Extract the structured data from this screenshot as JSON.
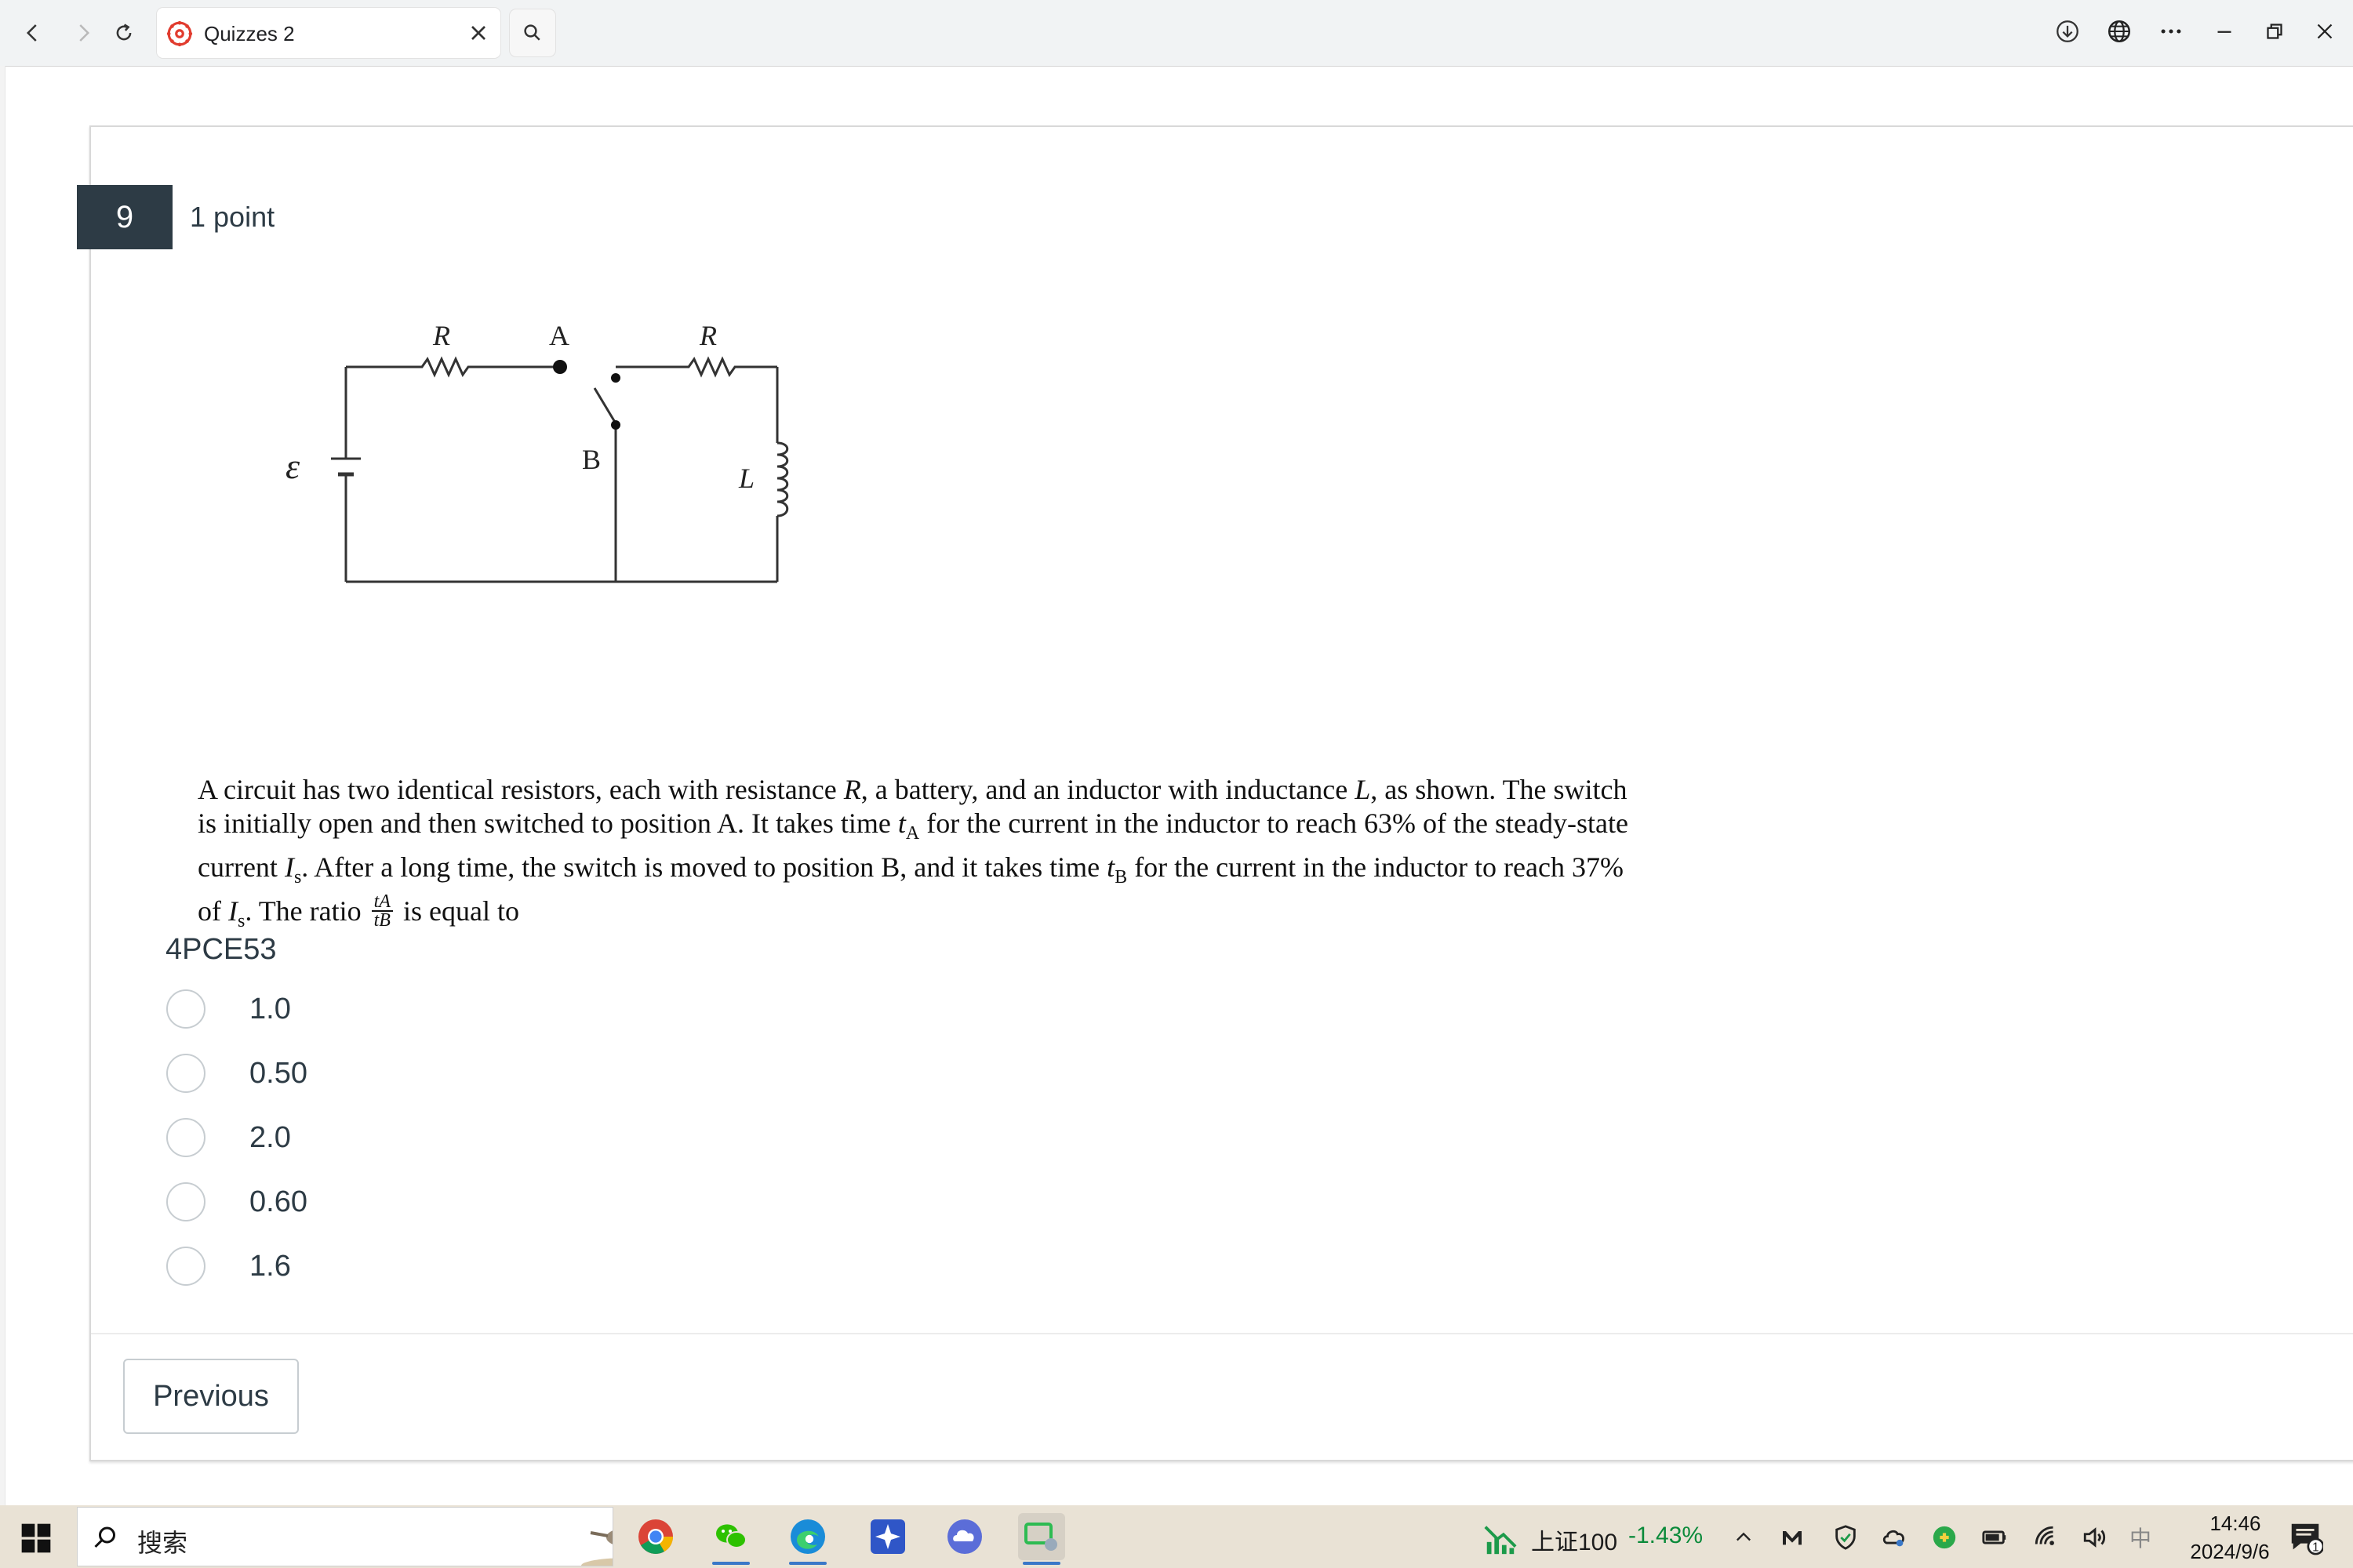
{
  "browser": {
    "tab_title": "Quizzes 2"
  },
  "question": {
    "number": "9",
    "points": "1 point",
    "code": "4PCE53",
    "text_parts": {
      "p1": "A circuit has two identical resistors, each with resistance ",
      "R": "R",
      "p2": ", a battery, and an inductor with inductance ",
      "L": "L",
      "p3": ", as shown. The switch is initially open and then switched to position ",
      "A": "A",
      "p4": ". It takes time ",
      "tA_t": "t",
      "tA_sub": "A",
      "p5": " for the current in the inductor to reach ",
      "pct63": "63%",
      "p6": " of the steady-state current ",
      "Is_I": "I",
      "Is_sub": "s",
      "p7": ". After a long time, the switch is moved to position ",
      "B": "B",
      "p8": ", and it takes time ",
      "tB_t": "t",
      "tB_sub": "B",
      "p9": " for the current in the inductor to reach ",
      "pct37": "37%",
      "p10": " of ",
      "Is2_I": "I",
      "Is2_sub": "s",
      "p11": ". The ratio ",
      "frac_num": "tA",
      "frac_den": "tB",
      "p12": " is equal to"
    },
    "answers": [
      {
        "label": "1.0"
      },
      {
        "label": "0.50"
      },
      {
        "label": "2.0"
      },
      {
        "label": "0.60"
      },
      {
        "label": "1.6"
      }
    ]
  },
  "figure": {
    "labels": {
      "R_left": "R",
      "R_right": "R",
      "A": "A",
      "B": "B",
      "emf": "ε",
      "L": "L"
    }
  },
  "navigation": {
    "previous": "Previous"
  },
  "taskbar": {
    "search_placeholder": "搜索",
    "stock_name": "上证100",
    "stock_change": "-1.43%",
    "ime": "中",
    "time": "14:46",
    "date": "2024/9/6",
    "notifications": "1"
  }
}
